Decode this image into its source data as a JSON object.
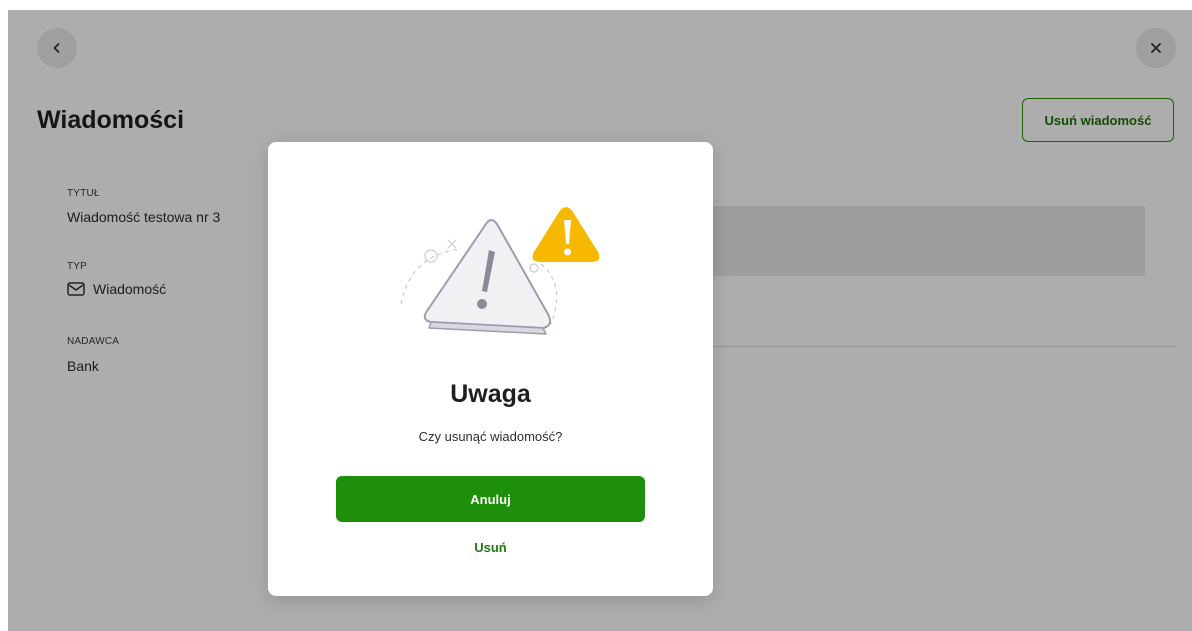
{
  "header": {
    "title": "Wiadomości",
    "delete_button_label": "Usuń wiadomość",
    "back_icon": "chevron-left-icon",
    "close_icon": "close-icon"
  },
  "details": {
    "title_label": "TYTUŁ",
    "title_value": "Wiadomość testowa nr 3",
    "type_label": "TYP",
    "type_value": "Wiadomość",
    "type_icon": "envelope-icon",
    "sender_label": "NADAWCA",
    "sender_value": "Bank"
  },
  "modal": {
    "illustration": "warning-triangle-icon",
    "title": "Uwaga",
    "message": "Czy usunąć wiadomość?",
    "cancel_label": "Anuluj",
    "confirm_label": "Usuń"
  },
  "colors": {
    "accent_green": "#1e8f0a",
    "warning_yellow": "#f6b800"
  }
}
